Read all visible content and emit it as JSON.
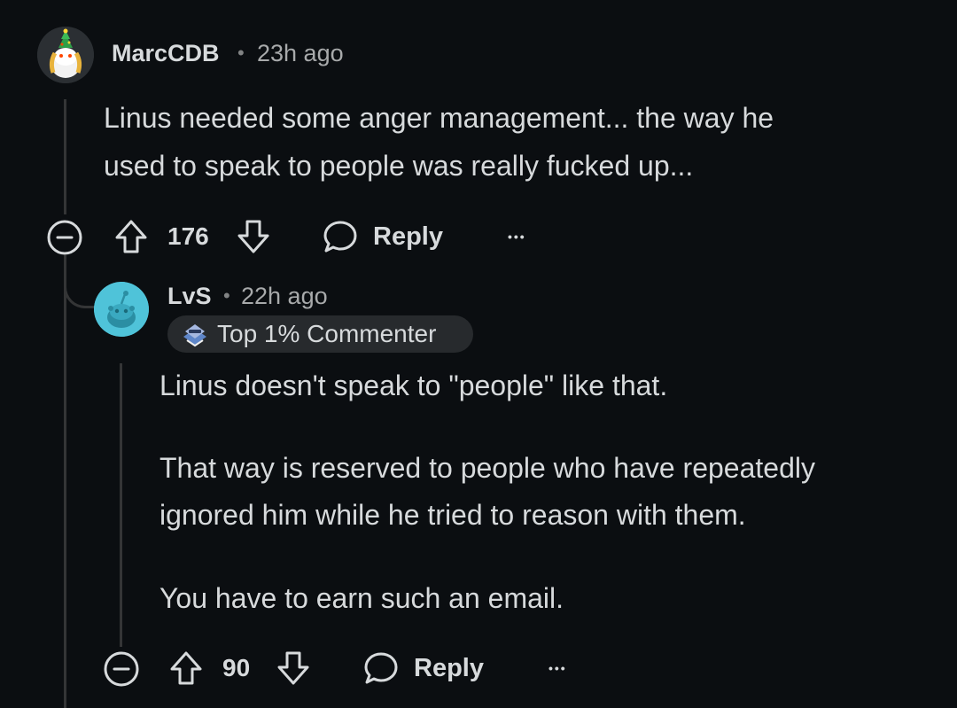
{
  "comments": [
    {
      "username": "MarcCDB",
      "separator": "•",
      "time": "23h ago",
      "body_lines": [
        "Linus needed some anger management... the way he",
        "used to speak to people was really fucked up..."
      ],
      "votes": "176",
      "reply_label": "Reply",
      "more_label": "•••",
      "avatar_icon": "snoo-christmas-avatar-icon"
    },
    {
      "username": "LvS",
      "separator": "•",
      "time": "22h ago",
      "badge": "Top 1% Commenter",
      "badge_icon": "top-commenter-icon",
      "paragraphs": [
        "Linus doesn't speak to \"people\" like that.",
        "That way is reserved to people who have repeatedly ignored him while he tried to reason with them.",
        "You have to earn such an email."
      ],
      "paragraph_lines": [
        [
          "Linus doesn't speak to \"people\" like that."
        ],
        [
          "That way is reserved to people who have repeatedly",
          "ignored him while he tried to reason with them."
        ],
        [
          "You have to earn such an email."
        ]
      ],
      "votes": "90",
      "reply_label": "Reply",
      "more_label": "•••",
      "avatar_icon": "snoo-default-avatar-icon",
      "avatar_color": "#4fc3d9"
    }
  ],
  "colors": {
    "background": "#0b0e11",
    "text": "#d7dadc",
    "muted": "#a8aaab",
    "thread_line": "#343536",
    "badge_bg": "#272a2d"
  }
}
